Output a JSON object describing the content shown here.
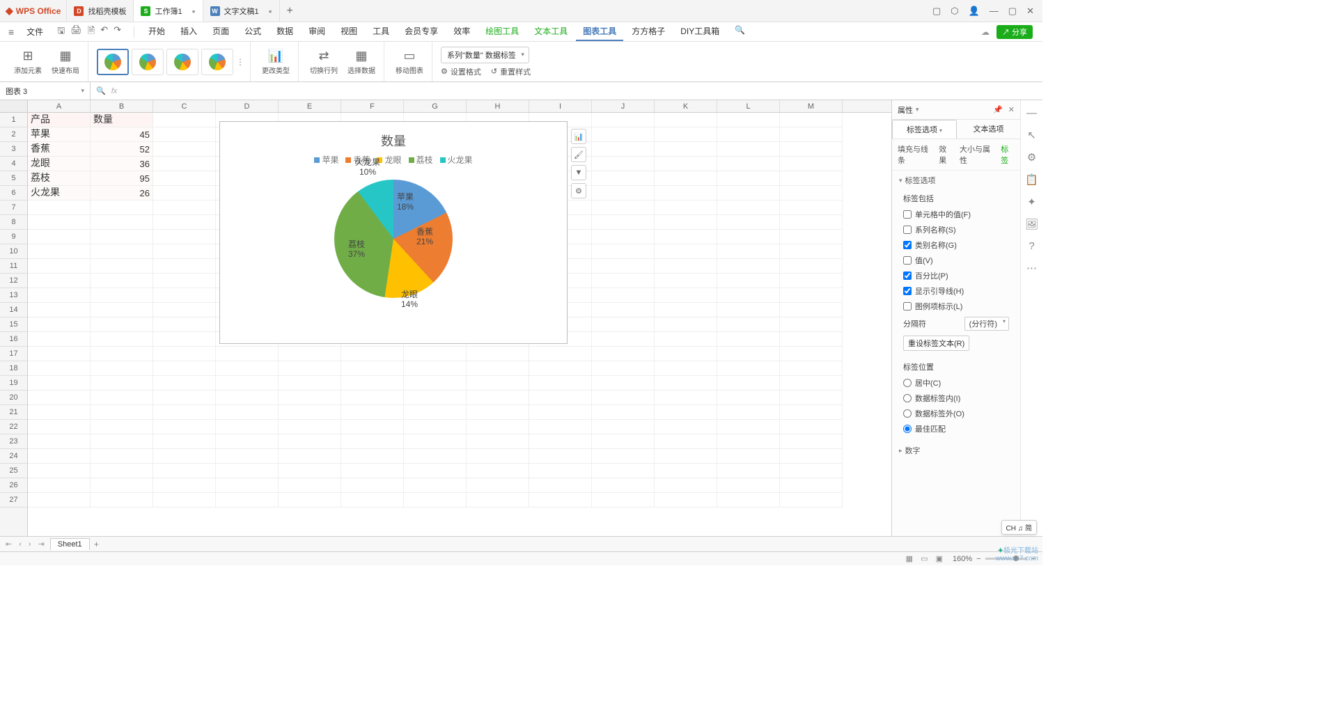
{
  "titlebar": {
    "app_name": "WPS Office",
    "tabs": [
      {
        "icon_bg": "#d24726",
        "icon_text": "D",
        "label": "找稻壳模板"
      },
      {
        "icon_bg": "#1aad19",
        "icon_text": "S",
        "label": "工作簿1",
        "active": true,
        "dirty": "•"
      },
      {
        "icon_bg": "#4a7ebb",
        "icon_text": "W",
        "label": "文字文稿1",
        "dirty": "•"
      }
    ],
    "new_tab": "+"
  },
  "menubar": {
    "file": "文件",
    "tabs": [
      "开始",
      "插入",
      "页面",
      "公式",
      "数据",
      "审阅",
      "视图",
      "工具",
      "会员专享",
      "效率"
    ],
    "green_tabs": [
      "绘图工具",
      "文本工具"
    ],
    "active_tab": "图表工具",
    "extra_tabs": [
      "方方格子",
      "DIY工具箱"
    ],
    "share": "分享"
  },
  "ribbon": {
    "add_elem": "添加元素",
    "quick_layout": "快速布局",
    "change_type": "更改类型",
    "switch_rc": "切换行列",
    "select_data": "选择数据",
    "move_chart": "移动图表",
    "series_selector": "系列\"数量\" 数据标签",
    "set_format": "设置格式",
    "reset_style": "重置样式"
  },
  "namebox": "图表 3",
  "fx_hint": "fx",
  "sheet": {
    "columns": [
      "A",
      "B",
      "C",
      "D",
      "E",
      "F",
      "G",
      "H",
      "I",
      "J",
      "K",
      "L",
      "M"
    ],
    "rows": 27,
    "data": [
      [
        "产品",
        "数量"
      ],
      [
        "苹果",
        "45"
      ],
      [
        "香蕉",
        "52"
      ],
      [
        "龙眼",
        "36"
      ],
      [
        "荔枝",
        "95"
      ],
      [
        "火龙果",
        "26"
      ]
    ]
  },
  "chart_data": {
    "type": "pie",
    "title": "数量",
    "categories": [
      "苹果",
      "香蕉",
      "龙眼",
      "荔枝",
      "火龙果"
    ],
    "values": [
      45,
      52,
      36,
      95,
      26
    ],
    "percentages": [
      "18%",
      "21%",
      "14%",
      "37%",
      "10%"
    ],
    "colors": [
      "#5b9bd5",
      "#ed7d31",
      "#ffc000",
      "#70ad47",
      "#26c6c6"
    ],
    "legend_position": "top",
    "data_labels": [
      {
        "text": "苹果",
        "pct": "18%"
      },
      {
        "text": "香蕉",
        "pct": "21%"
      },
      {
        "text": "龙眼",
        "pct": "14%"
      },
      {
        "text": "荔枝",
        "pct": "37%"
      },
      {
        "text": "火龙果",
        "pct": "10%"
      }
    ]
  },
  "props": {
    "title": "属性",
    "tab_label": "标签选项",
    "tab_text": "文本选项",
    "subtabs": [
      "填充与线条",
      "效果",
      "大小与属性",
      "标签"
    ],
    "active_subtab": "标签",
    "section_label_options": "标签选项",
    "label_contains": "标签包括",
    "checks": {
      "cell_val": "单元格中的值(F)",
      "series": "系列名称(S)",
      "category": "类别名称(G)",
      "value": "值(V)",
      "percent": "百分比(P)",
      "leader": "显示引导线(H)",
      "legend_key": "图例项标示(L)"
    },
    "separator_label": "分隔符",
    "separator_value": "(分行符)",
    "reset_label": "重设标签文本(R)",
    "position_label": "标签位置",
    "positions": {
      "center": "居中(C)",
      "inside": "数据标签内(I)",
      "outside": "数据标签外(O)",
      "bestfit": "最佳匹配"
    },
    "section_number": "数字"
  },
  "sheet_tab": {
    "name": "Sheet1"
  },
  "status": {
    "zoom": "160%",
    "ime": "CH ♫ 简"
  },
  "watermark": {
    "l1": "极光下载站",
    "l2": "www.xz7.com"
  }
}
